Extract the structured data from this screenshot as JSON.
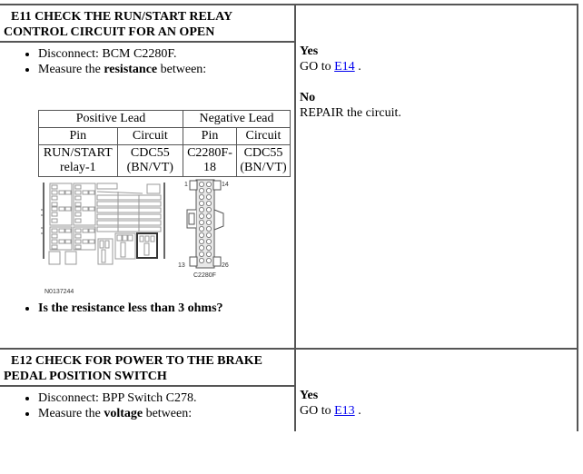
{
  "steps": [
    {
      "id": "E11",
      "title_line1": "E11 CHECK THE RUN/START RELAY",
      "title_line2": "CONTROL CIRCUIT FOR AN OPEN",
      "bullets": [
        {
          "text": "Disconnect: BCM C2280F."
        },
        {
          "prefix": "Measure the ",
          "bold": "resistance",
          "suffix": " between:"
        }
      ],
      "table": {
        "group_headers": [
          "Positive Lead",
          "Negative Lead"
        ],
        "sub_headers": [
          "Pin",
          "Circuit",
          "Pin",
          "Circuit"
        ],
        "rows": [
          [
            "RUN/START relay-1",
            "CDC55 (BN/VT)",
            "C2280F-18",
            "CDC55 (BN/VT)"
          ]
        ]
      },
      "figure": {
        "id_label": "N0137244",
        "connector_label": "C2280F",
        "pin_labels": [
          "1",
          "14",
          "13",
          "26"
        ]
      },
      "question": "Is the resistance less than 3 ohms?",
      "outcomes": {
        "yes_label": "Yes",
        "yes_action_prefix": "GO to ",
        "yes_link": "E14",
        "yes_action_suffix": " .",
        "no_label": "No",
        "no_action": "REPAIR the circuit."
      }
    },
    {
      "id": "E12",
      "title_line1": "E12 CHECK FOR POWER TO THE BRAKE",
      "title_line2": "PEDAL POSITION SWITCH",
      "bullets": [
        {
          "text": "Disconnect: BPP Switch C278."
        },
        {
          "prefix": "Measure the ",
          "bold": "voltage",
          "suffix": " between:"
        }
      ],
      "outcomes": {
        "yes_label": "Yes",
        "yes_action_prefix": "GO to ",
        "yes_link": "E13",
        "yes_action_suffix": " ."
      }
    }
  ]
}
